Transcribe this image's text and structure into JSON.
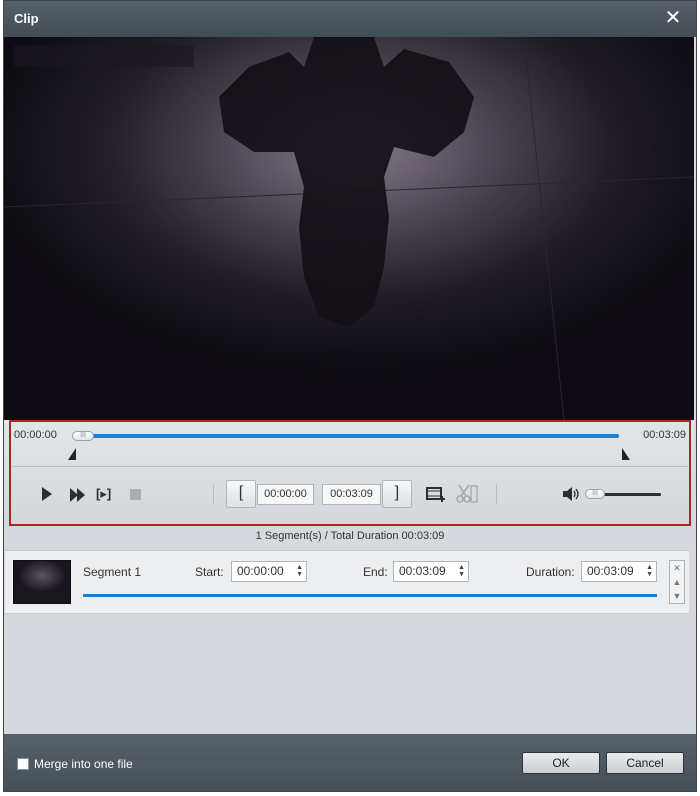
{
  "window": {
    "title": "Clip"
  },
  "player": {
    "time_start": "00:00:00",
    "time_end": "00:03:09",
    "thumb_grip": "III",
    "start_field": "00:00:00",
    "end_field": "00:03:09",
    "bracket_left": "[",
    "bracket_right": "]",
    "clipplay_label": "[▸]",
    "volume_grip": "III"
  },
  "summary": {
    "text": "1 Segment(s) / Total Duration 00:03:09"
  },
  "segments": [
    {
      "name": "Segment 1",
      "start_label": "Start:",
      "start": "00:00:00",
      "end_label": "End:",
      "end": "00:03:09",
      "duration_label": "Duration:",
      "duration": "00:03:09"
    }
  ],
  "footer": {
    "merge_label": "Merge into one file",
    "ok_label": "OK",
    "cancel_label": "Cancel"
  },
  "colors": {
    "accent": "#1c7fd0",
    "highlight": "#b2242a",
    "titlebar": "#4a545e"
  }
}
